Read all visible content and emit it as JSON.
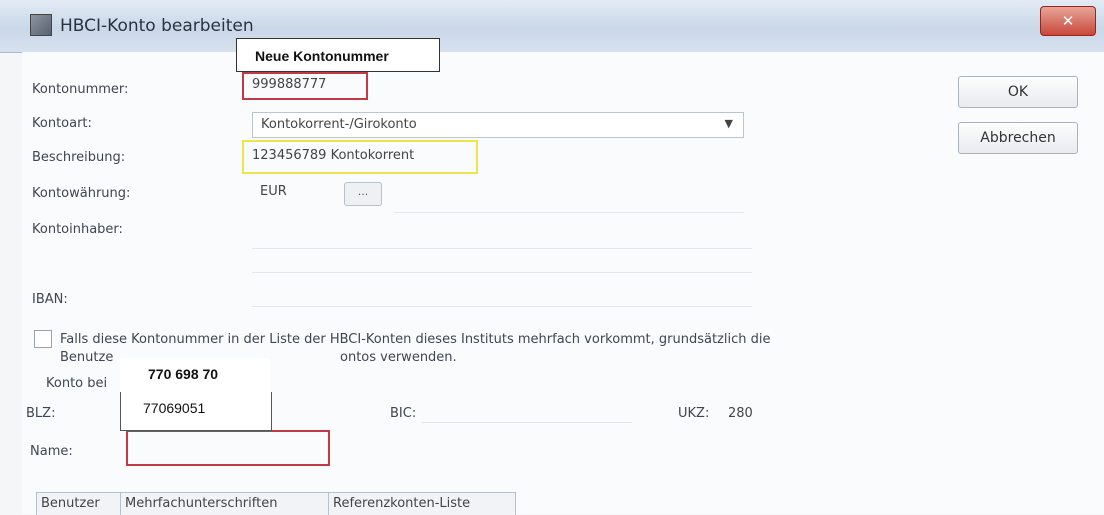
{
  "window": {
    "title": "HBCI-Konto bearbeiten",
    "close_glyph": "✕"
  },
  "annotations": {
    "neue_kontonummer": "Neue Kontonummer",
    "blz_override": "770 698 70",
    "blz_old": "77069051"
  },
  "form": {
    "kontonummer_label": "Kontonummer:",
    "kontonummer_value": "999888777",
    "kontoart_label": "Kontoart:",
    "kontoart_value": "Kontokorrent-/Girokonto",
    "beschreibung_label": "Beschreibung:",
    "beschreibung_value": "123456789 Kontokorrent",
    "waehrung_label": "Kontowährung:",
    "waehrung_value": "EUR",
    "waehrung_button": "...",
    "kontoinhaber_label": "Kontoinhaber:",
    "iban_label": "IBAN:",
    "checkbox_text_line1": "Falls diese Kontonummer in der Liste der HBCI-Konten dieses Instituts mehrfach vorkommt, grundsätzlich die",
    "checkbox_text_line2_a": "Benutze",
    "checkbox_text_line2_b": "ontos verwenden.",
    "konto_bei_label": "Konto bei",
    "blz_label": "BLZ:",
    "bic_label": "BIC:",
    "ukz_label": "UKZ:",
    "ukz_value": "280",
    "name_label": "Name:"
  },
  "buttons": {
    "ok": "OK",
    "cancel": "Abbrechen"
  },
  "tabs": [
    "Benutzer",
    "Mehrfachunterschriften",
    "Referenzkonten-Liste"
  ],
  "colors": {
    "highlight_red": "#c03a48",
    "highlight_yellow": "#efe44b"
  }
}
